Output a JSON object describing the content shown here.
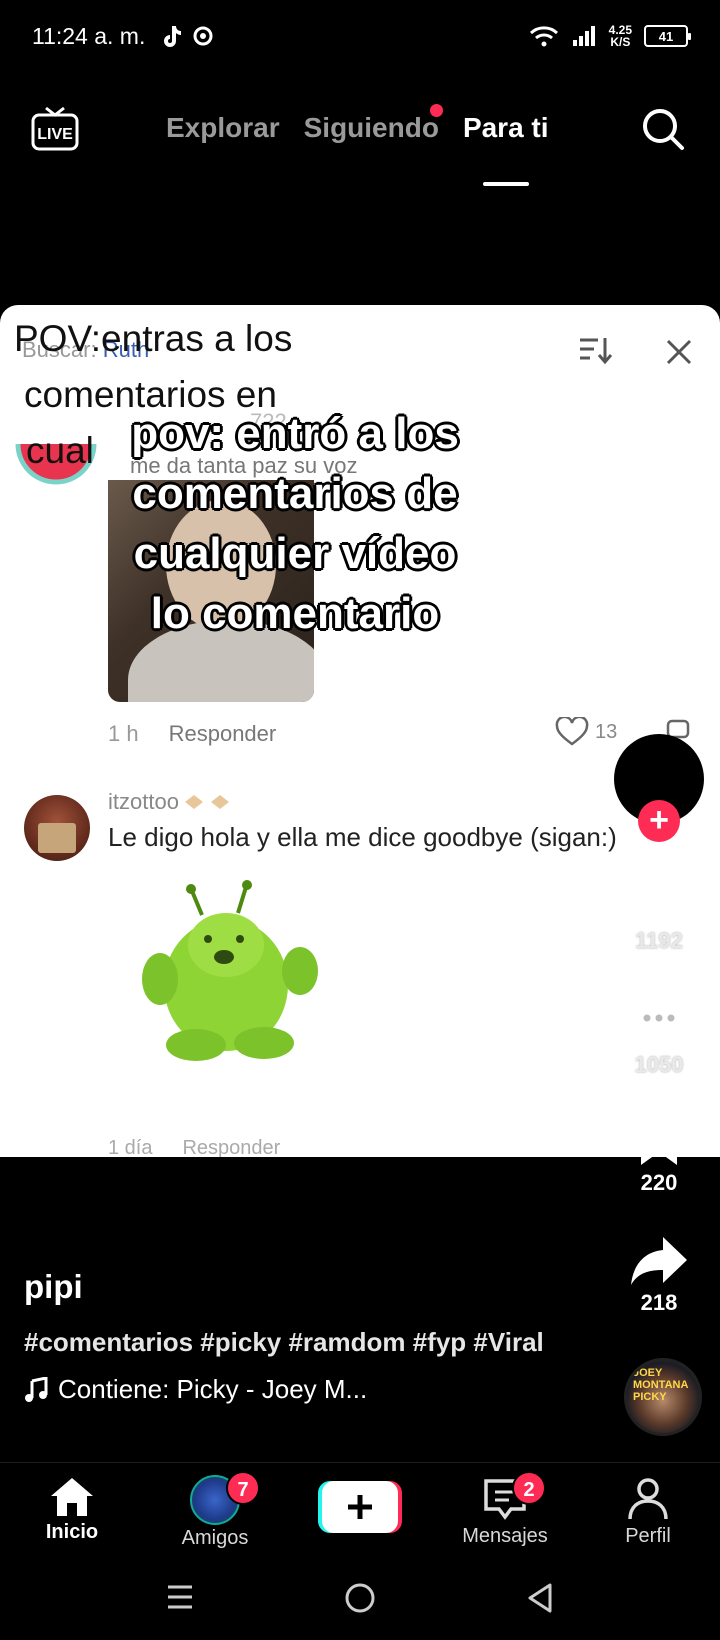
{
  "status_bar": {
    "time": "11:24 a. m.",
    "speed_value": "4.25",
    "speed_unit": "K/S",
    "battery": "41"
  },
  "top_nav": {
    "tabs": [
      {
        "label": "Explorar"
      },
      {
        "label": "Siguiendo"
      },
      {
        "label": "Para ti"
      }
    ],
    "live_icon": "live-tv-icon",
    "search_icon": "search-icon"
  },
  "video": {
    "header_lines": [
      "POV:entras a los",
      "comentarios en",
      "cual"
    ],
    "search_prefix": "Buscar:",
    "search_term": "Ruth",
    "ghost_count": "722",
    "ghost_comment": "me da tanta paz su voz",
    "comment1": {
      "time": "1 h",
      "reply": "Responder",
      "likes": "13"
    },
    "comment2": {
      "username": "itzottoo",
      "text": "Le digo hola y ella me dice goodbye (sigan:)"
    },
    "ghost_bottom_time": "1 día",
    "ghost_bottom_reply": "Responder",
    "caption_lines": [
      "pov: entró a los",
      "comentarios de",
      "cualquier vídeo",
      "lo comentario"
    ]
  },
  "rail": {
    "likes": "1192",
    "comments": "1050",
    "saves": "220",
    "shares": "218",
    "disc_text": "JOEY MONTANA PICKY"
  },
  "info": {
    "author": "pipi",
    "hashtags": "#comentarios #picky #ramdom #fyp #Viral",
    "music": "Contiene: Picky - Joey M..."
  },
  "tabbar": {
    "home": "Inicio",
    "friends": "Amigos",
    "friends_badge": "7",
    "messages": "Mensajes",
    "messages_badge": "2",
    "profile": "Perfil"
  },
  "colors": {
    "accent": "#fe2c55",
    "background": "#000000"
  }
}
